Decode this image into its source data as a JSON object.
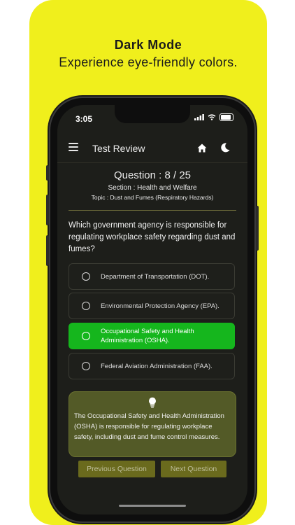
{
  "promo": {
    "headline": "Dark Mode",
    "subtitle": "Experience eye-friendly colors."
  },
  "status_bar": {
    "time": "3:05"
  },
  "app_bar": {
    "title": "Test Review"
  },
  "question_header": {
    "counter": "Question : 8 / 25",
    "section": "Section : Health and Welfare",
    "topic": "Topic : Dust and Fumes (Respiratory Hazards)"
  },
  "question": {
    "text": "Which government agency is responsible for regulating workplace safety regarding dust and fumes?",
    "options": [
      {
        "label": "Department of Transportation (DOT).",
        "correct": false
      },
      {
        "label": "Environmental Protection Agency (EPA).",
        "correct": false
      },
      {
        "label": "Occupational Safety and Health Administration (OSHA).",
        "correct": true
      },
      {
        "label": "Federal Aviation Administration (FAA).",
        "correct": false
      }
    ]
  },
  "explanation": {
    "text": "The Occupational Safety and Health Administration (OSHA) is responsible for regulating workplace safety, including dust and fume control measures."
  },
  "navigation": {
    "previous_label": "Previous Question",
    "next_label": "Next Question"
  },
  "colors": {
    "promo_background": "#f0ef1c",
    "screen_background": "#1d1e1a",
    "correct_option": "#15b61d",
    "explanation_card": "#535a27",
    "nav_button": "#6a6a1d"
  },
  "icons": [
    "menu-icon",
    "home-icon",
    "moon-icon",
    "signal-icon",
    "wifi-icon",
    "battery-icon",
    "radio-icon",
    "lightbulb-icon"
  ]
}
